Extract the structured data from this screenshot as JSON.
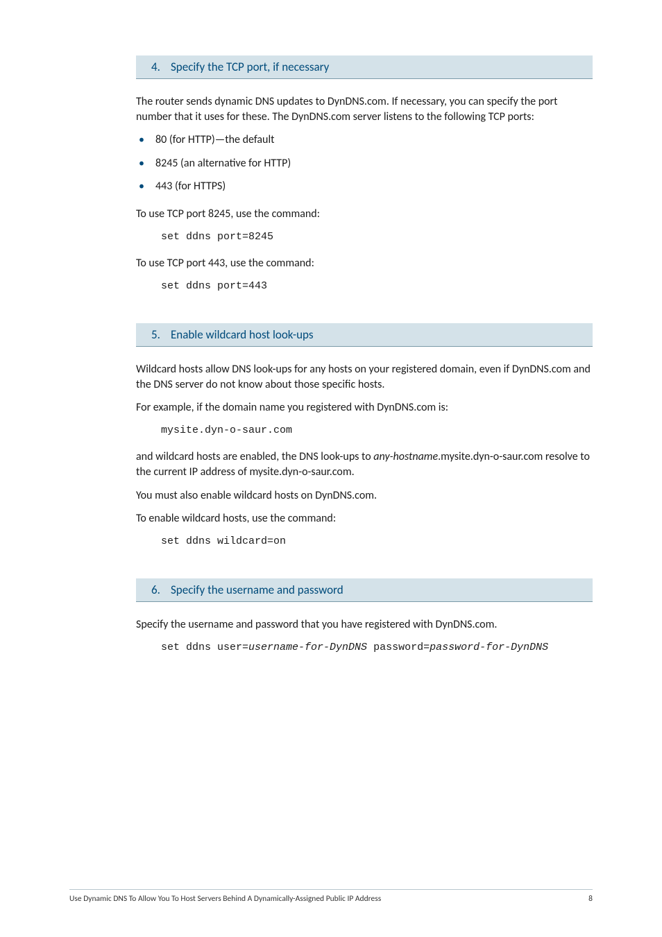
{
  "steps": [
    {
      "num": "4.",
      "title": "Specify the TCP port, if necessary",
      "intro": "The router sends dynamic DNS updates to DynDNS.com. If necessary, you can specify the port number that it uses for these. The DynDNS.com server listens to the following TCP ports:",
      "bullets": [
        "80 (for HTTP)—the default",
        "8245 (an alternative for HTTP)",
        "443 (for HTTPS)"
      ],
      "para1": "To use TCP port 8245, use the command:",
      "code1": "set ddns port=8245",
      "para2": "To use TCP port 443, use the command:",
      "code2": "set ddns port=443"
    },
    {
      "num": "5.",
      "title": "Enable wildcard host look-ups",
      "intro": "Wildcard hosts allow DNS look-ups for any hosts on your registered domain, even if DynDNS.com and the DNS server do not know about those specific hosts.",
      "para1": "For example, if the domain name you registered with DynDNS.com is:",
      "code1": "mysite.dyn-o-saur.com",
      "para2_pre": "and wildcard hosts are enabled, the DNS look-ups to ",
      "para2_em": "any-hostname",
      "para2_post": ".mysite.dyn-o-saur.com resolve to the current IP address of mysite.dyn-o-saur.com.",
      "para3": "You must also enable wildcard hosts on DynDNS.com.",
      "para4": "To enable wildcard hosts, use the command:",
      "code2": "set ddns wildcard=on"
    },
    {
      "num": "6.",
      "title": "Specify the username and password",
      "intro": "Specify the username and password that you have registered with DynDNS.com.",
      "code_pre": "set ddns user=",
      "code_em1": "username-for-DynDNS",
      "code_mid": " password=",
      "code_em2": "password-for-DynDNS"
    }
  ],
  "footer": {
    "title": "Use Dynamic DNS To Allow You To Host Servers Behind A Dynamically-Assigned Public IP Address",
    "page": "8"
  }
}
